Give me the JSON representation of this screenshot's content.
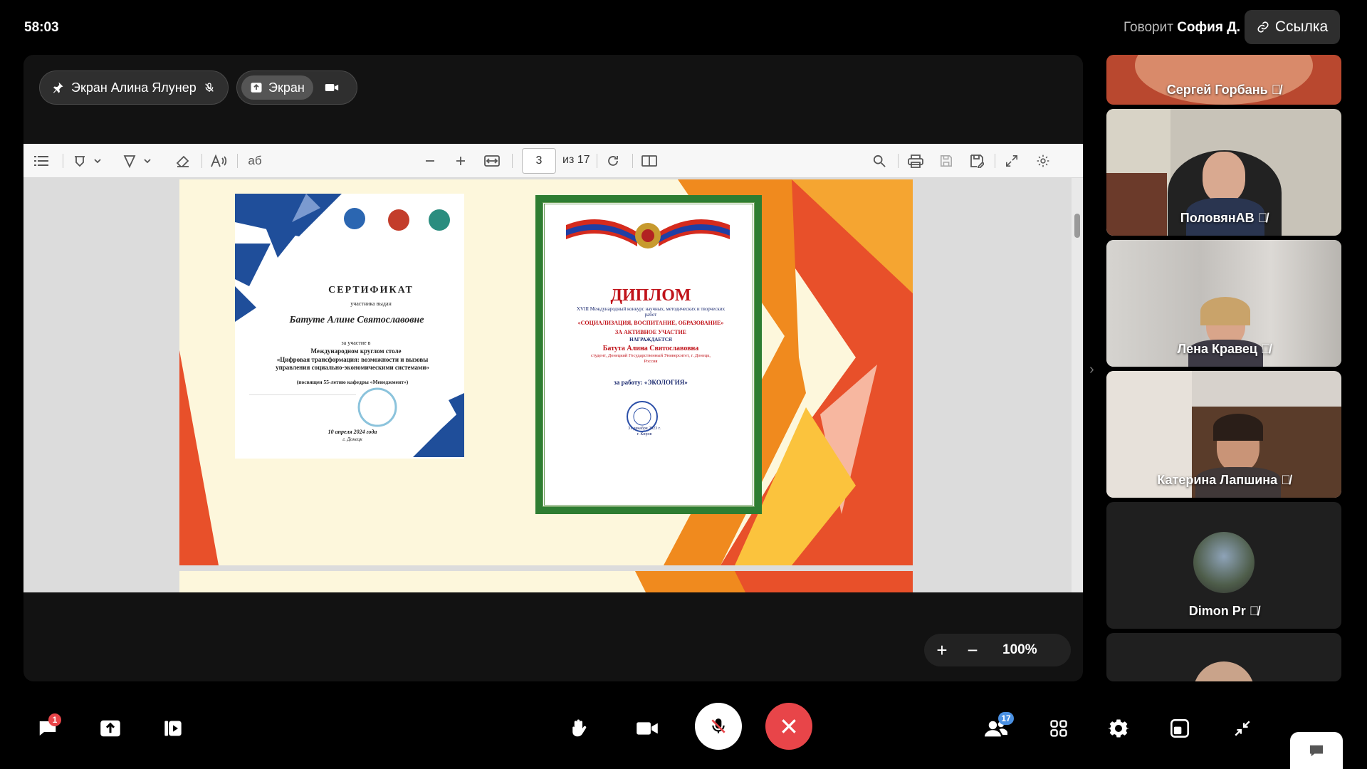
{
  "header": {
    "timer": "58:03",
    "speaker_prefix": "Говорит",
    "speaker_name": "София Д.",
    "link_label": "Ссылка"
  },
  "stage": {
    "pinned_label": "Экран Алина Ялунер",
    "screen_label": "Экран"
  },
  "pdf_toolbar": {
    "page_current": "3",
    "page_total": "из 17"
  },
  "certificate": {
    "title": "СЕРТИФИКАТ",
    "subtitle": "участника выдан",
    "name": "Батуте Алине Святославовне",
    "line1": "за участие в",
    "line2": "Международном круглом столе",
    "line3": "«Цифровая трансформация: возможности и вызовы управления социально-экономическими системами»",
    "line4": "(посвящен 55-летию кафедры «Менеджмент»)",
    "date": "10 апреля 2024 года",
    "city": "г. Донецк"
  },
  "diploma": {
    "title": "ДИПЛОМ",
    "line1": "XVIII Международный конкурс научных, методических и творческих работ",
    "line2": "«СОЦИАЛИЗАЦИЯ, ВОСПИТАНИЕ, ОБРАЗОВАНИЕ»",
    "line3": "ЗА АКТИВНОЕ УЧАСТИЕ",
    "line4": "НАГРАЖДАЕТСЯ",
    "name": "Батута Алина Святославовна",
    "line5": "студент, Донецкий Государственный Университет, г. Донецк, Россия",
    "work": "за работу: «ЭКОЛОГИЯ»",
    "date": "31 декабря 2023 г.",
    "city": "г. Киров"
  },
  "zoom": {
    "level": "100%"
  },
  "participants": [
    {
      "name": "Сергей Горбань"
    },
    {
      "name": "ПоловянАВ"
    },
    {
      "name": "Лена Кравец"
    },
    {
      "name": "Катерина Лапшина"
    },
    {
      "name": "Dimon Pr"
    }
  ],
  "bottom_bar": {
    "chat_badge": "1",
    "participants_badge": "17"
  },
  "colors": {
    "end_call": "#e84549",
    "badge_red": "#e84549",
    "badge_blue": "#4a90e2",
    "slide_orange": "#f08a1e",
    "slide_red": "#e8502a"
  }
}
